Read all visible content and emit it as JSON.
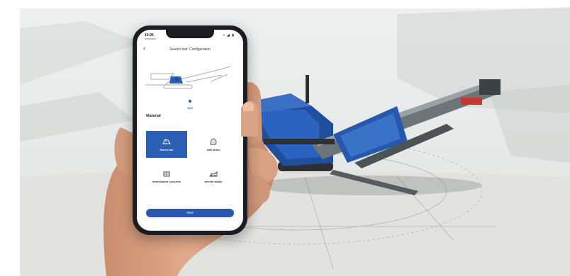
{
  "status_bar": {
    "time": "10:26",
    "carrier": "Kleemann",
    "icons": "▪ ◢ ▮"
  },
  "app": {
    "title": "Search tool: Configuration",
    "step_label": "Soil",
    "section_title": "Material",
    "materials": [
      {
        "label": "Hard rock",
        "icon": "hard-rock-icon",
        "selected": true
      },
      {
        "label": "soft stone",
        "icon": "soft-stone-icon",
        "selected": false
      },
      {
        "label": "demolished concrete",
        "icon": "demolition-icon",
        "selected": false
      },
      {
        "label": "mixed rubble",
        "icon": "rubble-icon",
        "selected": false
      }
    ],
    "next_label": "Next"
  },
  "colors": {
    "accent": "#2b5fb4",
    "machine_blue": "#1f4f9c"
  }
}
